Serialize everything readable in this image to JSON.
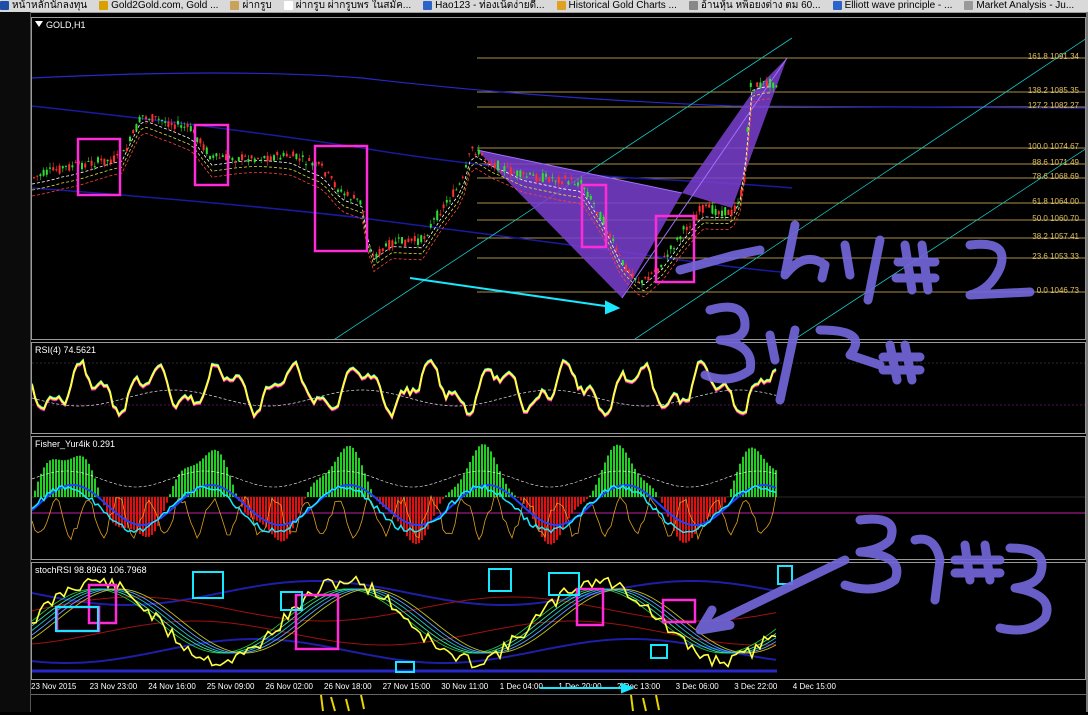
{
  "bookmarks": [
    {
      "label": "หน้าหลักนักลงทุน",
      "color": "#1e4fa8"
    },
    {
      "label": "Gold2Gold.com, Gold ...",
      "color": "#d8a000"
    },
    {
      "label": "ผ่ากรูบ",
      "color": "#c9a35a"
    },
    {
      "label": "ผ่ากรูบ ผ่ากรูบพร ในสมัค...",
      "color": "#ffffff"
    },
    {
      "label": "Hao123 - ท่องเน็ตง่ายดี...",
      "color": "#2d62c8"
    },
    {
      "label": "Historical Gold Charts ...",
      "color": "#e0a020"
    },
    {
      "label": "อ้านหุ้น หพ็อยงต่าง ตม 60...",
      "color": "#888888"
    },
    {
      "label": "Elliott wave principle - ...",
      "color": "#2d62c8"
    },
    {
      "label": "Market Analysis - Ju...",
      "color": "#999999"
    }
  ],
  "main_pane": {
    "title": "GOLD,H1",
    "fib_levels": [
      {
        "ratio": "161.8",
        "price": "1091.34"
      },
      {
        "ratio": "138.2",
        "price": "1085.35"
      },
      {
        "ratio": "127.2",
        "price": "1082.27"
      },
      {
        "ratio": "100.0",
        "price": "1074.67"
      },
      {
        "ratio": "88.6",
        "price": "1071.49"
      },
      {
        "ratio": "78.6",
        "price": "1068.69"
      },
      {
        "ratio": "61.8",
        "price": "1064.00"
      },
      {
        "ratio": "50.0",
        "price": "1060.70"
      },
      {
        "ratio": "38.2",
        "price": "1057.41"
      },
      {
        "ratio": "23.6",
        "price": "1053.33"
      },
      {
        "ratio": "0.0",
        "price": "1046.73"
      }
    ]
  },
  "rsi_pane": {
    "title": "RSI(4) 74.5621"
  },
  "fisher_pane": {
    "title": "Fisher_Yur4ik 0.291"
  },
  "stoch_pane": {
    "title": "stochRSI 98.8963 106.7968"
  },
  "time_axis": [
    "23 Nov 2015",
    "23 Nov 23:00",
    "24 Nov 16:00",
    "25 Nov 09:00",
    "26 Nov 02:00",
    "26 Nov 18:00",
    "27 Nov 15:00",
    "30 Nov 11:00",
    "1 Dec 04:00",
    "1 Dec 20:00",
    "2 Dec 13:00",
    "3 Dec 06:00",
    "3 Dec 22:00",
    "4 Dec 15:00"
  ],
  "annotations": {
    "buy2": "buy #2",
    "buy1": "Buy #1",
    "buy3": "Buy #3"
  },
  "colors": {
    "fib": "#e0c060",
    "pattern": "#7a3fd0",
    "box_magenta": "#ff2bd6",
    "box_cyan": "#19e6ff",
    "handwriting": "#7266d8",
    "rsi_yellow": "#ffff40",
    "hist_green": "#20d020",
    "hist_red": "#e01010"
  }
}
